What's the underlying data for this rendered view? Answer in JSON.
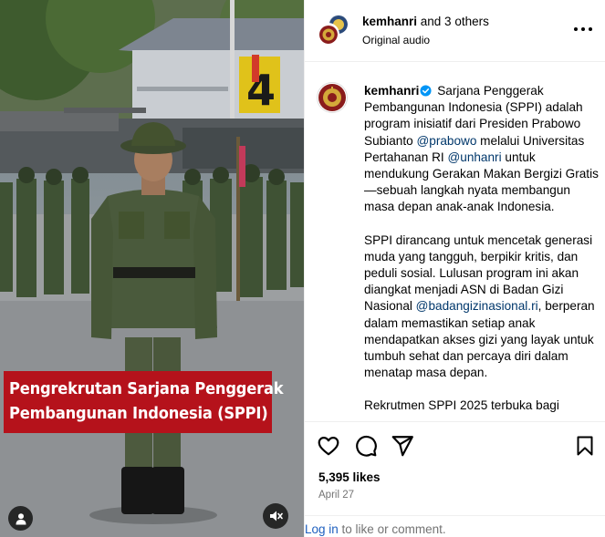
{
  "post": {
    "media": {
      "overlay_line1": "Pengrekrutan Sarjana Penggerak",
      "overlay_line2": "Pembangunan Indonesia (SPPI)",
      "sign_number": "4",
      "tag_icon": "person-icon",
      "mute_icon": "speaker-muted-icon"
    },
    "header": {
      "username": "kemhanri",
      "and_others": " and 3 others",
      "subtitle": "Original audio",
      "more_icon": "more-horizontal-icon"
    },
    "caption": {
      "username": "kemhanri",
      "segments_p1": [
        {
          "text": " Sarjana Penggerak Pembangunan Indonesia (SPPI) adalah program inisiatif dari Presiden Prabowo Subianto ",
          "mention": false
        },
        {
          "text": "@prabowo",
          "mention": true
        },
        {
          "text": " melalui Universitas Pertahanan RI ",
          "mention": false
        },
        {
          "text": "@unhanri",
          "mention": true
        },
        {
          "text": " untuk mendukung Gerakan Makan Bergizi Gratis—sebuah langkah nyata membangun masa depan anak-anak Indonesia.",
          "mention": false
        }
      ],
      "segments_p2": [
        {
          "text": "SPPI dirancang untuk mencetak generasi muda yang tangguh, berpikir kritis, dan peduli sosial. Lulusan program ini akan diangkat menjadi ASN di Badan Gizi Nasional ",
          "mention": false
        },
        {
          "text": "@badangizinasional.ri",
          "mention": true
        },
        {
          "text": ", berperan dalam memastikan setiap anak mendapatkan akses gizi yang layak untuk tumbuh sehat dan percaya diri dalam menatap masa depan.",
          "mention": false
        }
      ],
      "p3": "Rekrutmen SPPI 2025 terbuka bagi"
    },
    "actions": {
      "like_icon": "heart-icon",
      "comment_icon": "comment-icon",
      "share_icon": "share-icon",
      "save_icon": "bookmark-icon"
    },
    "likes": "5,395 likes",
    "date": "April 27",
    "login": {
      "link_text": "Log in",
      "rest": " to like or comment."
    }
  },
  "colors": {
    "overlay_red": "#b5121b",
    "mention_blue": "#00376b",
    "verified_blue": "#0095f6",
    "muted_text": "#737373",
    "uniform_green": "#4a5a3c"
  }
}
